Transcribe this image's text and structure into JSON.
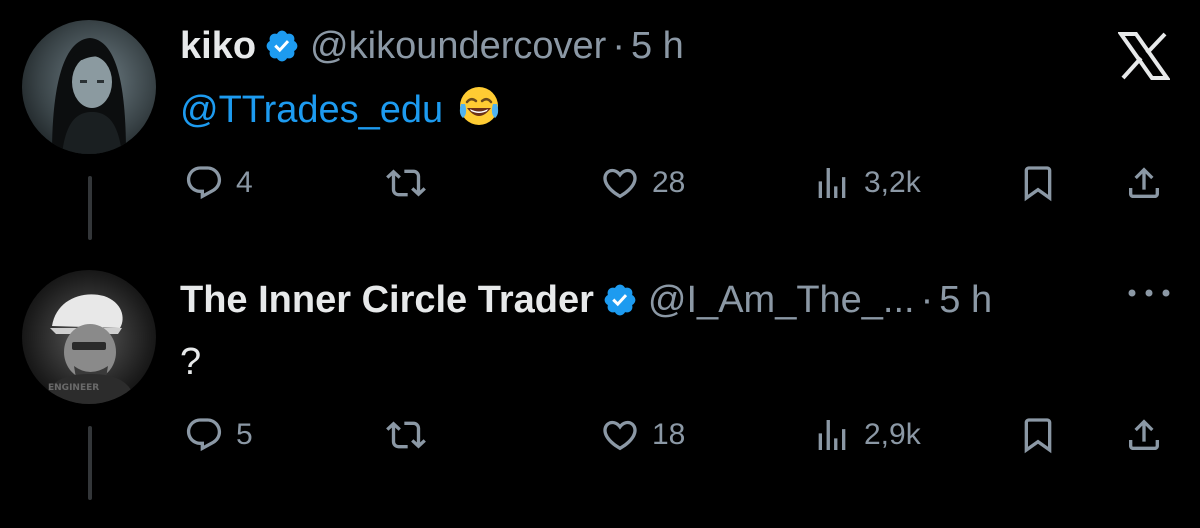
{
  "app": {
    "logo_icon": "x-logo-icon"
  },
  "colors": {
    "background": "#000000",
    "text": "#e7e9ea",
    "muted": "#8b98a5",
    "accent": "#1d9bf0"
  },
  "tweets": [
    {
      "name": "kiko",
      "handle": "@kikoundercover",
      "separator": "·",
      "time": "5 h",
      "verified": true,
      "mention": "@TTrades_edu",
      "text": "",
      "emoji_icon": "face-with-tears-of-joy-icon",
      "replies": "4",
      "reposts": "",
      "likes": "28",
      "views": "3,2k"
    },
    {
      "name": "The Inner Circle Trader",
      "handle": "@I_Am_The_...",
      "separator": "·",
      "time": "5 h",
      "verified": true,
      "mention": "",
      "text": "?",
      "replies": "5",
      "reposts": "",
      "likes": "18",
      "views": "2,9k",
      "avatar_text": "ENGINEER",
      "more_icon": "more-options-icon"
    }
  ]
}
